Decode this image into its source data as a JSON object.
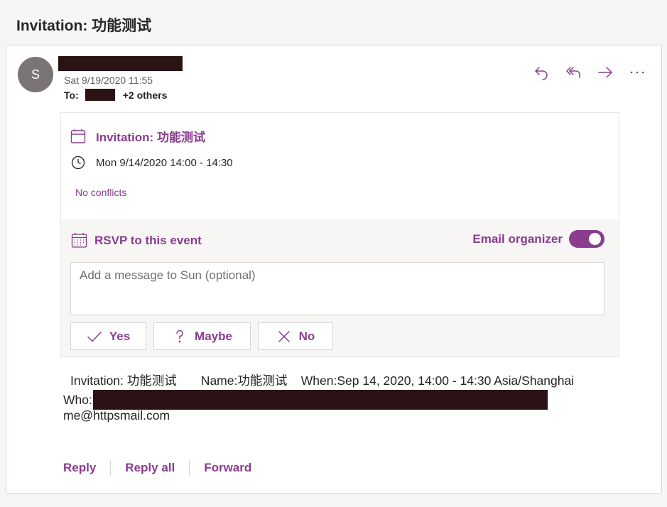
{
  "page": {
    "title": "Invitation: 功能测试"
  },
  "message": {
    "avatar_initial": "S",
    "date": "Sat 9/19/2020 11:55",
    "to_label": "To:",
    "to_others": "+2 others"
  },
  "actions": [
    {
      "name": "reply",
      "icon": "reply-icon"
    },
    {
      "name": "reply-all",
      "icon": "reply-all-icon"
    },
    {
      "name": "forward",
      "icon": "forward-icon"
    },
    {
      "name": "more",
      "icon": "more-icon"
    }
  ],
  "invite": {
    "title": "Invitation: 功能测试",
    "time": "Mon 9/14/2020 14:00 - 14:30",
    "conflicts": "No conflicts",
    "rsvp_label": "RSVP to this event",
    "email_organizer_label": "Email organizer",
    "email_organizer_on": true,
    "message_placeholder": "Add a message to Sun (optional)",
    "yes_label": "Yes",
    "maybe_label": "Maybe",
    "no_label": "No"
  },
  "body": {
    "line1": "Invitation: 功能测试       Name:功能测试    When:Sep 14, 2020, 14:00 - 14:30 Asia/Shanghai",
    "who_label": "Who:",
    "line3": "me@httpsmail.com"
  },
  "footer": {
    "reply": "Reply",
    "reply_all": "Reply all",
    "forward": "Forward"
  },
  "colors": {
    "accent": "#8a3c8f",
    "avatar": "#7a7574",
    "redaction": "#2b1315"
  }
}
